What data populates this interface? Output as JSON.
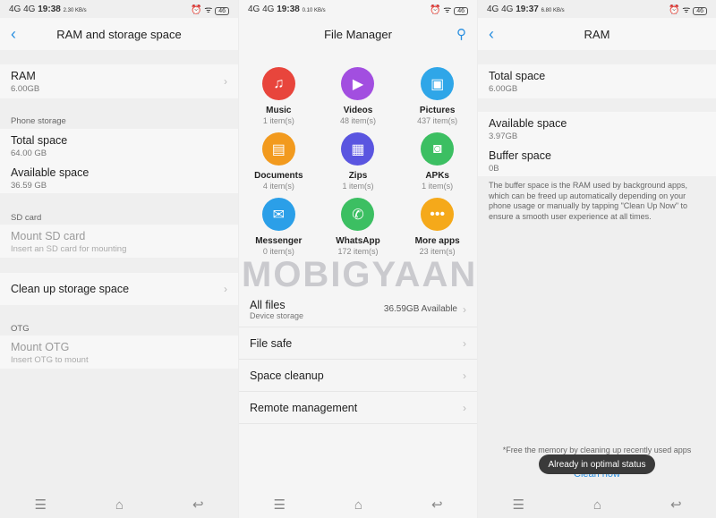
{
  "status_bars": [
    {
      "network": "4G 4G",
      "time": "19:38",
      "speed": "2.30 KB/s",
      "battery": "46"
    },
    {
      "network": "4G 4G",
      "time": "19:38",
      "speed": "0.10 KB/s",
      "battery": "46"
    },
    {
      "network": "4G 4G",
      "time": "19:37",
      "speed": "6.80 KB/s",
      "battery": "46"
    }
  ],
  "storage": {
    "title": "RAM and storage space",
    "ram": {
      "label": "RAM",
      "value": "6.00GB"
    },
    "phone_section": "Phone storage",
    "total": {
      "label": "Total space",
      "value": "64.00 GB"
    },
    "available": {
      "label": "Available space",
      "value": "36.59 GB"
    },
    "sd_section": "SD card",
    "mount_sd": {
      "label": "Mount SD card",
      "value": "Insert an SD card for mounting"
    },
    "cleanup": {
      "label": "Clean up storage space"
    },
    "otg_section": "OTG",
    "mount_otg": {
      "label": "Mount OTG",
      "value": "Insert OTG to mount"
    }
  },
  "file_manager": {
    "title": "File Manager",
    "categories": [
      {
        "name": "Music",
        "count": "1 item(s)",
        "color": "#e8453c",
        "icon": "♫"
      },
      {
        "name": "Videos",
        "count": "48 item(s)",
        "color": "#a24ee0",
        "icon": "▶"
      },
      {
        "name": "Pictures",
        "count": "437 item(s)",
        "color": "#2fa6e8",
        "icon": "▣"
      },
      {
        "name": "Documents",
        "count": "4 item(s)",
        "color": "#f29a1e",
        "icon": "▤"
      },
      {
        "name": "Zips",
        "count": "1 item(s)",
        "color": "#5a55e0",
        "icon": "▦"
      },
      {
        "name": "APKs",
        "count": "1 item(s)",
        "color": "#3cbf62",
        "icon": "◙"
      },
      {
        "name": "Messenger",
        "count": "0 item(s)",
        "color": "#2b9fe8",
        "icon": "✉"
      },
      {
        "name": "WhatsApp",
        "count": "172 item(s)",
        "color": "#3cbf62",
        "icon": "✆"
      },
      {
        "name": "More apps",
        "count": "23 item(s)",
        "color": "#f5a91a",
        "icon": "•••"
      }
    ],
    "all_files": {
      "label": "All files",
      "sub": "Device storage",
      "value": "36.59GB Available"
    },
    "file_safe": "File safe",
    "space_cleanup": "Space cleanup",
    "remote": "Remote management"
  },
  "ram": {
    "title": "RAM",
    "total": {
      "label": "Total space",
      "value": "6.00GB"
    },
    "available": {
      "label": "Available space",
      "value": "3.97GB"
    },
    "buffer": {
      "label": "Buffer space",
      "value": "0B"
    },
    "description": "The buffer space is the RAM used by background apps, which can be freed up automatically depending on your phone usage or manually by tapping \"Clean Up Now\" to ensure a smooth user experience at all times.",
    "footnote": "*Free the memory by cleaning up recently used apps",
    "toast": "Already in optimal status",
    "clean_now": "Clean now"
  },
  "watermark": "MOBIGYAAN",
  "accent": "#2a8fe0"
}
